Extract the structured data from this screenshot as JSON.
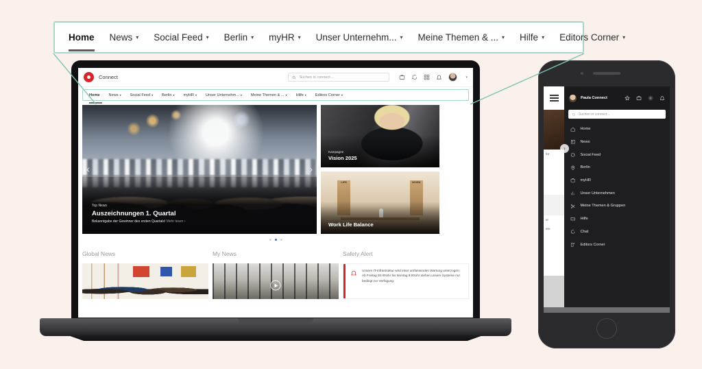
{
  "callout": {
    "items": [
      {
        "label": "Home",
        "caret": false,
        "active": true
      },
      {
        "label": "News",
        "caret": true,
        "active": false
      },
      {
        "label": "Social Feed",
        "caret": true,
        "active": false
      },
      {
        "label": "Berlin",
        "caret": true,
        "active": false
      },
      {
        "label": "myHR",
        "caret": true,
        "active": false
      },
      {
        "label": "Unser Unternehm...",
        "caret": true,
        "active": false
      },
      {
        "label": "Meine Themen & ...",
        "caret": true,
        "active": false
      },
      {
        "label": "Hilfe",
        "caret": true,
        "active": false
      },
      {
        "label": "Editors Corner",
        "caret": true,
        "active": false
      }
    ],
    "caret_glyph": "▾",
    "border_color": "#a8d5c8"
  },
  "laptop": {
    "app": {
      "brand": "Connect",
      "logo_icon": "location-pin-icon",
      "brand_color": "#d8232a",
      "search": {
        "placeholder": "Suchen in connect...",
        "icon": "search-icon"
      },
      "header_icons": [
        "briefcase-icon",
        "chat-icon",
        "apps-grid-icon",
        "bell-icon"
      ],
      "avatar": "user-avatar",
      "avatar_caret": "▾",
      "nav": [
        {
          "label": "Home",
          "caret": false,
          "active": true
        },
        {
          "label": "News",
          "caret": true,
          "active": false
        },
        {
          "label": "Social Feed",
          "caret": true,
          "active": false
        },
        {
          "label": "Berlin",
          "caret": true,
          "active": false
        },
        {
          "label": "myHR",
          "caret": true,
          "active": false
        },
        {
          "label": "Unser Unternehm...",
          "caret": true,
          "active": false
        },
        {
          "label": "Meine Themen & ...",
          "caret": true,
          "active": false
        },
        {
          "label": "Hilfe",
          "caret": true,
          "active": false
        },
        {
          "label": "Editors Corner",
          "caret": true,
          "active": false
        }
      ]
    },
    "hero": {
      "kicker": "Top News",
      "title": "Auszeichnungen 1. Quartal",
      "subtitle": "Bekanntgabe der Gewinner des ersten Quartals!",
      "more_link": "Mehr lesen ›",
      "prev_arrow": "‹",
      "next_arrow": "›",
      "dots_total": 3,
      "dot_active_index": 1,
      "dot_active_color": "#3d6fd6"
    },
    "side_cards": [
      {
        "kicker": "Kampagne",
        "title": "Vision 2025"
      },
      {
        "kicker": "",
        "title": "Work Life Balance"
      }
    ],
    "work_life_blocks": {
      "left": "LIFE",
      "right": "WORK"
    },
    "sections": [
      {
        "title": "Global News",
        "type": "image"
      },
      {
        "title": "My News",
        "type": "video"
      },
      {
        "title": "Safety Alert",
        "type": "alert"
      }
    ],
    "alert": {
      "icon": "bell-icon",
      "accent_color": "#d8232a",
      "text": "Unsere IT-Infrastruktur wird einer umfassenden Wartung unterzogen. Ab Freitag 20.00Uhr bis Montag 8.00Uhr stehen unsere Systeme nur bedingt zur Verfügung."
    }
  },
  "phone": {
    "menu_button": "hamburger-menu-icon",
    "user_name": "Paula Connect",
    "header_icons": [
      "star-icon",
      "briefcase-icon",
      "gear-icon",
      "bell-icon"
    ],
    "search": {
      "placeholder": "Suchen in connect...",
      "icon": "search-icon"
    },
    "menu_items": [
      {
        "label": "Home",
        "icon": "home-icon"
      },
      {
        "label": "News",
        "icon": "news-icon"
      },
      {
        "label": "Social Feed",
        "icon": "chat-bubble-icon"
      },
      {
        "label": "Berlin",
        "icon": "location-pin-icon"
      },
      {
        "label": "myHR",
        "icon": "briefcase-icon"
      },
      {
        "label": "Unser Unternehmen",
        "icon": "bar-chart-icon"
      },
      {
        "label": "Meine Themen & Gruppen",
        "icon": "scissors-icon"
      },
      {
        "label": "Hilfe",
        "icon": "folder-icon"
      },
      {
        "label": "Chat",
        "icon": "chat-icon"
      },
      {
        "label": "Editors Corner",
        "icon": "edit-square-icon"
      }
    ],
    "underlay_texts": [
      "für",
      "er",
      "ere"
    ],
    "slide_arrow": "›"
  },
  "theme": {
    "background": "#faf1ec",
    "accent": "#a8d5c8",
    "brand_red": "#d8232a"
  }
}
